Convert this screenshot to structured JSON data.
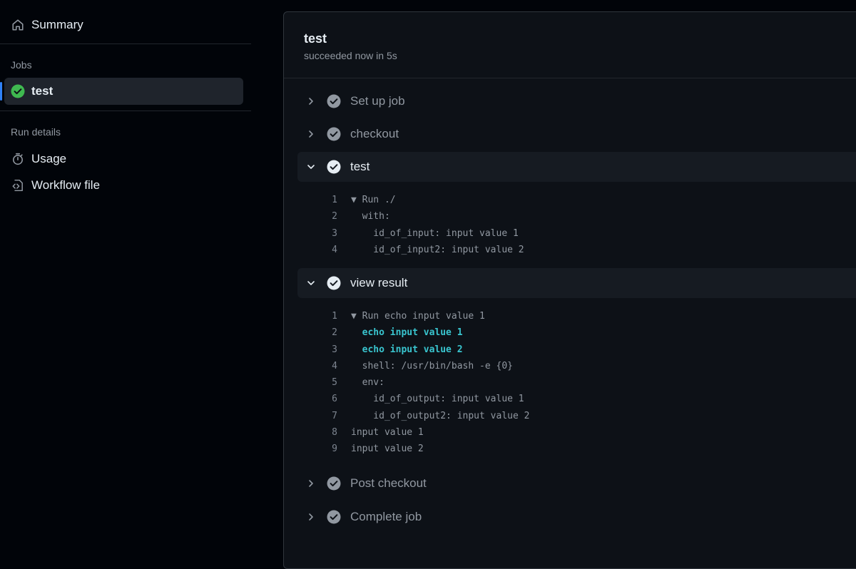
{
  "sidebar": {
    "summary_label": "Summary",
    "jobs_heading": "Jobs",
    "job_label": "test",
    "run_details_heading": "Run details",
    "usage_label": "Usage",
    "workflow_file_label": "Workflow file"
  },
  "job": {
    "title": "test",
    "status": "succeeded now in 5s"
  },
  "steps": [
    {
      "name": "Set up job"
    },
    {
      "name": "checkout"
    },
    {
      "name": "test"
    },
    {
      "name": "view result"
    },
    {
      "name": "Post checkout"
    },
    {
      "name": "Complete job"
    }
  ],
  "test_log": [
    {
      "n": "1",
      "text": "▼ Run ./"
    },
    {
      "n": "2",
      "text": "  with:"
    },
    {
      "n": "3",
      "text": "    id_of_input: input value 1"
    },
    {
      "n": "4",
      "text": "    id_of_input2: input value 2"
    }
  ],
  "view_result_log": [
    {
      "n": "1",
      "text": "▼ Run echo input value 1"
    },
    {
      "n": "2",
      "text": "  echo input value 1"
    },
    {
      "n": "3",
      "text": "  echo input value 2"
    },
    {
      "n": "4",
      "text": "  shell: /usr/bin/bash -e {0}"
    },
    {
      "n": "5",
      "text": "  env:"
    },
    {
      "n": "6",
      "text": "    id_of_output: input value 1"
    },
    {
      "n": "7",
      "text": "    id_of_output2: input value 2"
    },
    {
      "n": "8",
      "text": "input value 1"
    },
    {
      "n": "9",
      "text": "input value 2"
    }
  ],
  "colors": {
    "success": "#3fb950",
    "accent": "#2f81f7",
    "highlight": "#39c5cf"
  }
}
